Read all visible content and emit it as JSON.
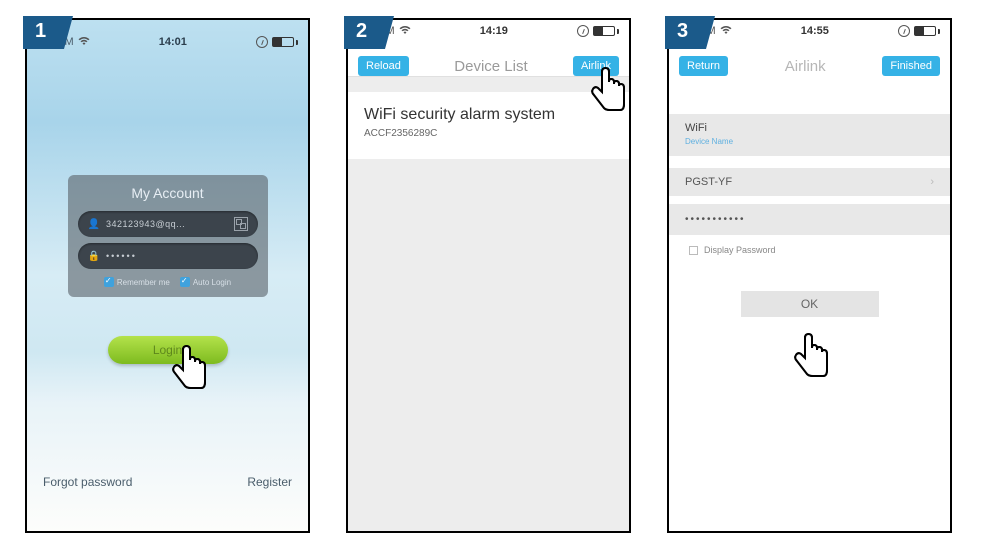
{
  "steps": [
    "1",
    "2",
    "3"
  ],
  "status": {
    "carrier": "No SIM"
  },
  "screen1": {
    "time": "14:01",
    "account_title": "My Account",
    "username": "342123943@qq...",
    "password_masked": "••••••",
    "remember": "Remember me",
    "autologin": "Auto Login",
    "login": "Login",
    "forgot": "Forgot password",
    "register": "Register"
  },
  "screen2": {
    "time": "14:19",
    "reload": "Reload",
    "title": "Device List",
    "airlink": "Airlink",
    "device_name": "WiFi security alarm system",
    "device_id": "ACCF2356289C"
  },
  "screen3": {
    "time": "14:55",
    "return": "Return",
    "title": "Airlink",
    "finished": "Finished",
    "wifi_label": "WiFi",
    "device_name_label": "Device Name",
    "ssid": "PGST-YF",
    "password_masked": "•••••••••••",
    "display_password": "Display Password",
    "ok": "OK"
  }
}
